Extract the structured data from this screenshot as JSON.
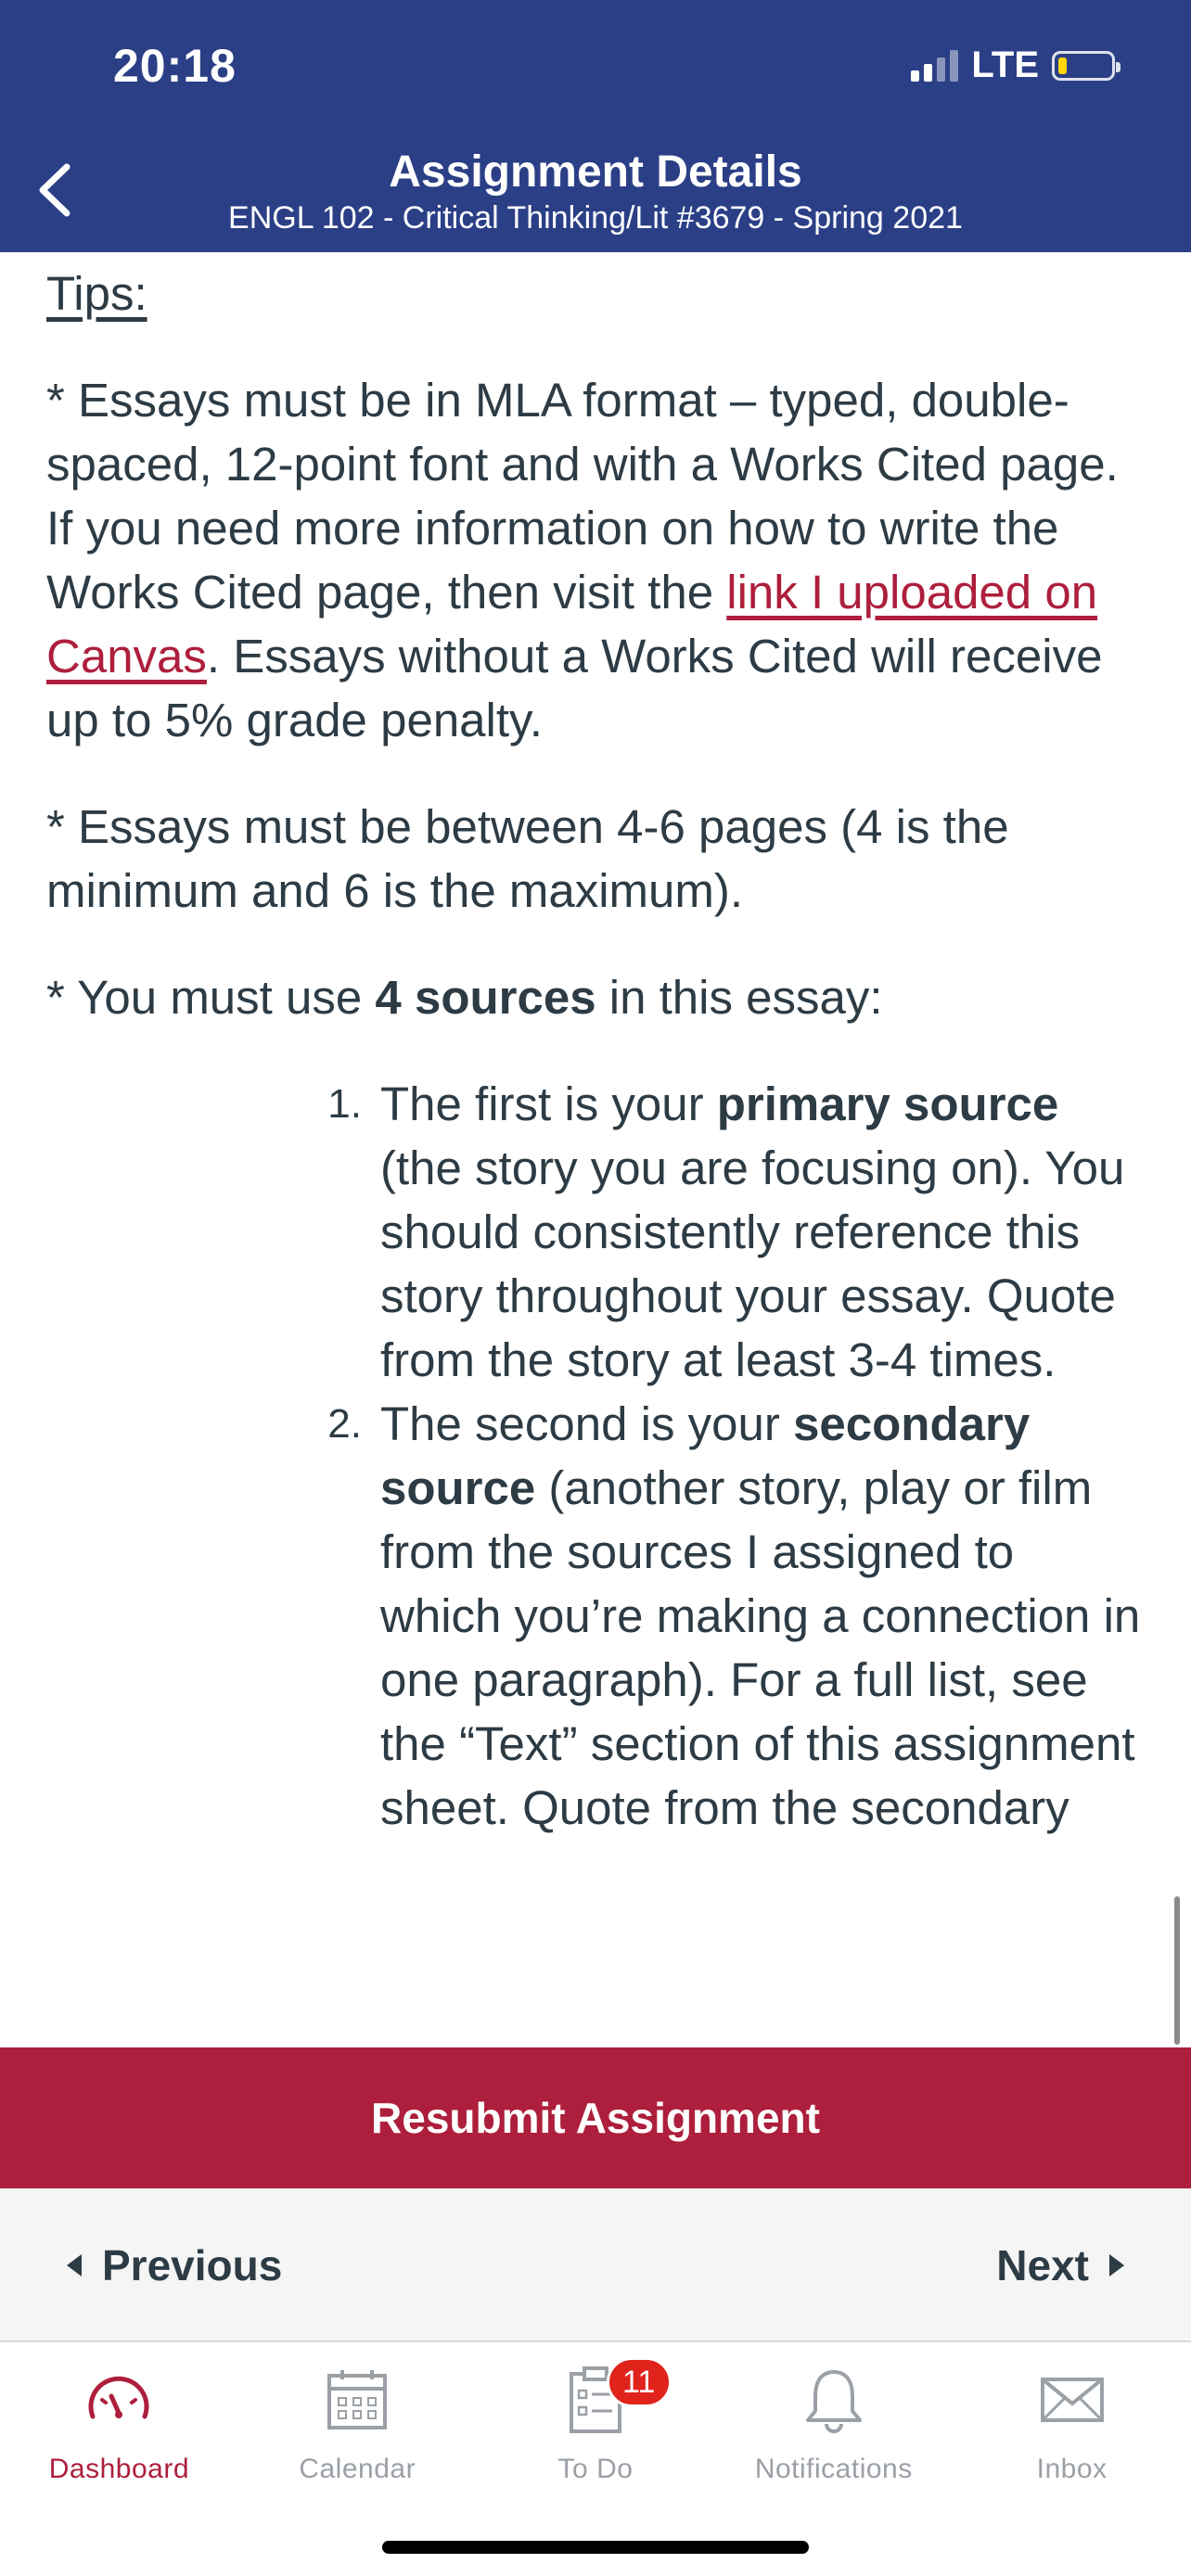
{
  "status_bar": {
    "time": "20:18",
    "network": "LTE"
  },
  "header": {
    "title": "Assignment Details",
    "subtitle": "ENGL 102 - Critical Thinking/Lit #3679 - Spring 2021",
    "back_icon": "chevron-left-icon"
  },
  "content": {
    "tips_heading": "Tips:",
    "para1": {
      "before_link": "* Essays must be in MLA format – typed, double-spaced, 12-point font and with a Works Cited page. If you need more information on how to write the Works Cited page, then visit the ",
      "link_text": "link I uploaded on Canvas",
      "after_link": ". Essays without a Works Cited will receive up to 5% grade penalty."
    },
    "para2": "* Essays must be between 4-6 pages (4 is the minimum and 6 is the maximum).",
    "para3": {
      "before_bold": "* You must use ",
      "bold": "4 sources",
      "after_bold": " in this essay:"
    },
    "sources": [
      {
        "number": "1.",
        "before_bold": "The first is your ",
        "bold": "primary source",
        "after_bold": " (the story you are focusing on). You should consistently reference this story throughout your essay. Quote from the story at least 3-4 times."
      },
      {
        "number": "2.",
        "before_bold": "The second is your ",
        "bold": "secondary source",
        "after_bold": " (another story, play or film from the sources I assigned to which you’re making a connection in one paragraph). For a full list, see the “Text” section of this assignment sheet. Quote from the secondary"
      }
    ]
  },
  "actions": {
    "resubmit_label": "Resubmit Assignment",
    "previous_label": "Previous",
    "next_label": "Next"
  },
  "tabbar": {
    "tabs": [
      {
        "label": "Dashboard",
        "icon": "dashboard-gauge-icon",
        "active": true
      },
      {
        "label": "Calendar",
        "icon": "calendar-icon",
        "active": false
      },
      {
        "label": "To Do",
        "icon": "todo-clipboard-icon",
        "active": false,
        "badge": "11"
      },
      {
        "label": "Notifications",
        "icon": "bell-icon",
        "active": false
      },
      {
        "label": "Inbox",
        "icon": "envelope-icon",
        "active": false
      }
    ]
  },
  "colors": {
    "header_bg": "#2b3f86",
    "accent": "#ad1f3c",
    "text": "#2d3b45",
    "inactive_tab": "#9aa0a6",
    "badge": "#e0241b"
  }
}
